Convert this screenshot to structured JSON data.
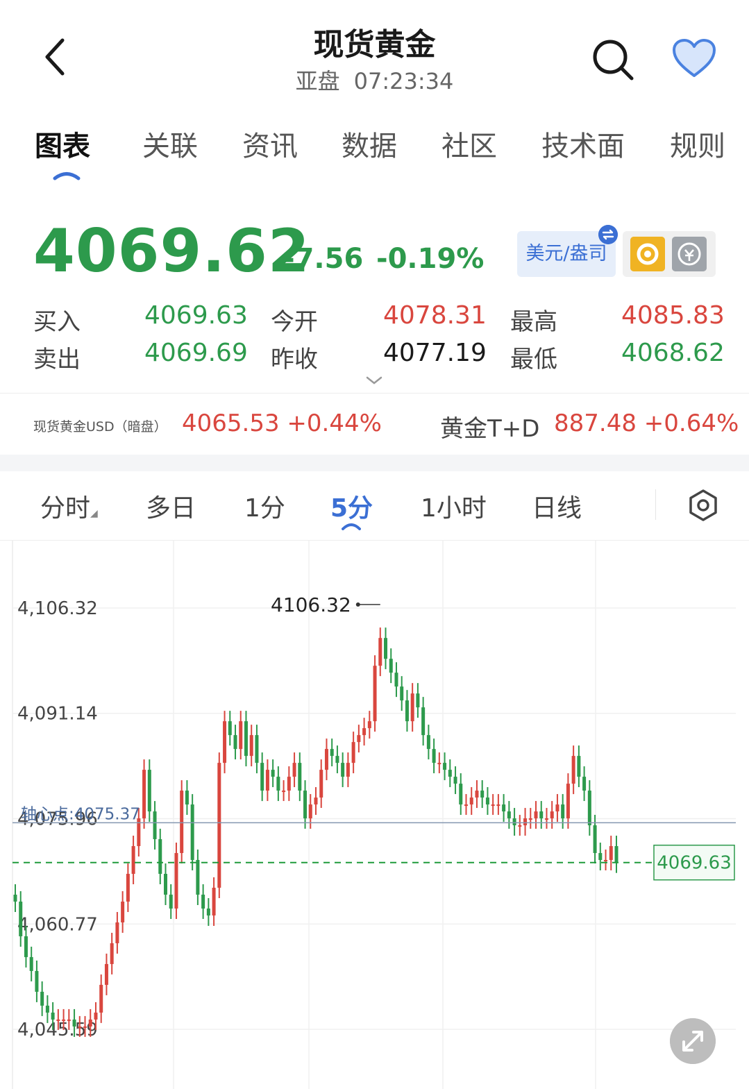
{
  "header": {
    "title": "现货黄金",
    "market": "亚盘",
    "time": "07:23:34"
  },
  "tabs": [
    "图表",
    "关联",
    "资讯",
    "数据",
    "社区",
    "技术面",
    "规则"
  ],
  "active_tab": "图表",
  "quote": {
    "price": "4069.62",
    "change": "-7.56",
    "change_pct": "-0.19%",
    "unit_button": "美元/盎司",
    "rows": [
      {
        "label": "买入",
        "value": "4069.63",
        "color": "#2d9a4c"
      },
      {
        "label": "今开",
        "value": "4078.31",
        "color": "#d9463e"
      },
      {
        "label": "最高",
        "value": "4085.83",
        "color": "#d9463e"
      },
      {
        "label": "卖出",
        "value": "4069.69",
        "color": "#2d9a4c"
      },
      {
        "label": "昨收",
        "value": "4077.19",
        "color": "#1a1a1a"
      },
      {
        "label": "最低",
        "value": "4068.62",
        "color": "#2d9a4c"
      }
    ]
  },
  "related": {
    "left_label": "现货黄金USD（暗盘）",
    "left_value": "4065.53 +0.44%",
    "right_label": "黄金T+D",
    "right_value": "887.48 +0.64%"
  },
  "period_tabs": [
    "分时",
    "多日",
    "1分",
    "5分",
    "1小时",
    "日线"
  ],
  "active_period": "5分",
  "colors": {
    "up": "#d9463e",
    "down": "#2d9a4c",
    "accent": "#3b6fd4"
  },
  "chart_data": {
    "type": "candlestick",
    "y_ticks": [
      "4,106.32",
      "4,091.14",
      "4,075.96",
      "4,060.77",
      "4,045.59"
    ],
    "ylim": [
      4045.59,
      4106.32
    ],
    "high_marker": "4106.32",
    "pivot_label": "轴心点:4075.37",
    "pivot_value": 4075.37,
    "current_price_label": "4069.63",
    "current_price": 4069.63,
    "series_close_approx": [
      4064,
      4059,
      4056,
      4054,
      4051,
      4049,
      4048,
      4047,
      4047,
      4047,
      4047,
      4046,
      4046,
      4046,
      4047,
      4048,
      4052,
      4055,
      4058,
      4061,
      4064,
      4068,
      4072,
      4076,
      4083,
      4077,
      4073,
      4068,
      4065,
      4063,
      4071,
      4080,
      4078,
      4070,
      4065,
      4063,
      4062,
      4066,
      4084,
      4090,
      4088,
      4086,
      4090,
      4085,
      4088,
      4084,
      4080,
      4083,
      4082,
      4080,
      4080,
      4082,
      4084,
      4080,
      4076,
      4078,
      4079,
      4083,
      4086,
      4085,
      4084,
      4082,
      4084,
      4087,
      4088,
      4089,
      4090,
      4098,
      4102,
      4099,
      4097,
      4095,
      4093,
      4090,
      4094,
      4092,
      4088,
      4086,
      4084,
      4084,
      4083,
      4082,
      4081,
      4078,
      4078,
      4079,
      4080,
      4079,
      4078,
      4078,
      4078,
      4077,
      4076,
      4075,
      4075,
      4076,
      4076,
      4077,
      4076,
      4076,
      4077,
      4078,
      4076,
      4081,
      4085,
      4082,
      4080,
      4075,
      4071,
      4070,
      4070,
      4072,
      4069.63
    ]
  }
}
